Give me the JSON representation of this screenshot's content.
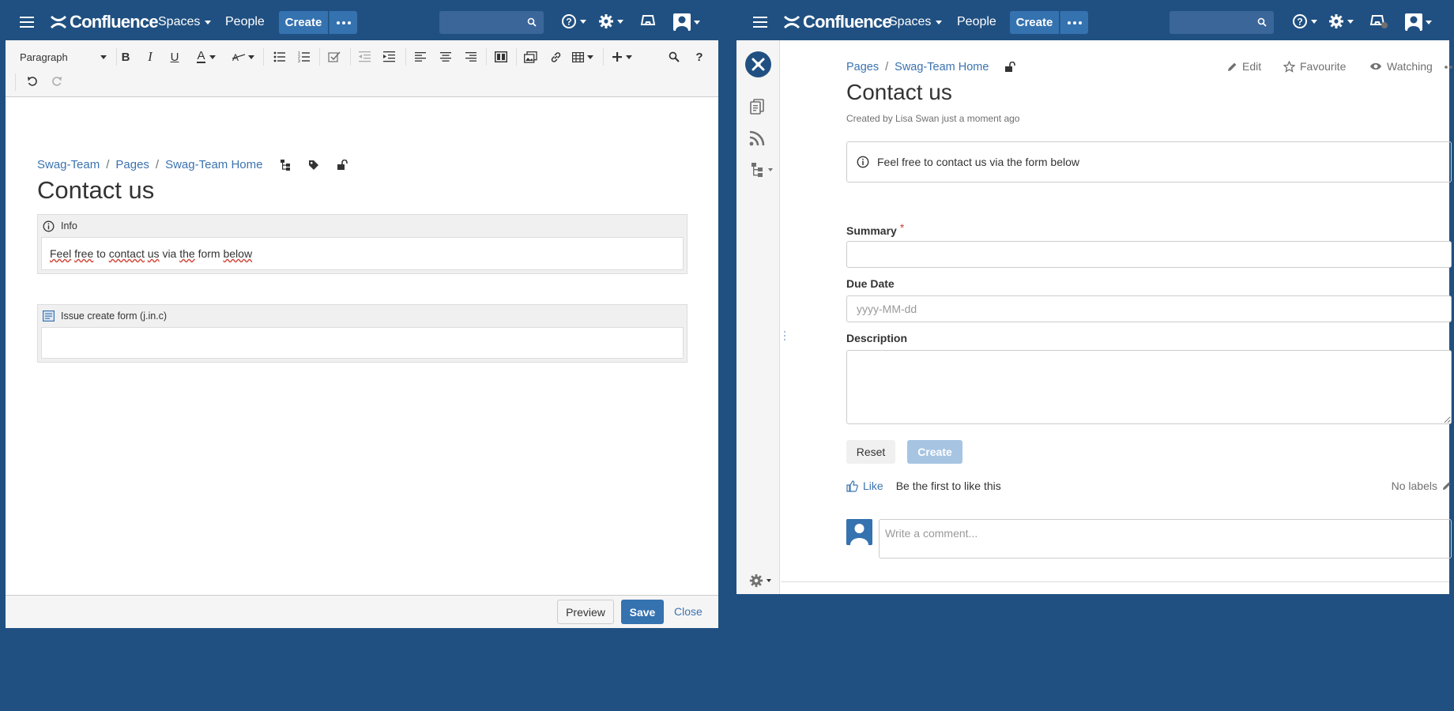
{
  "colors": {
    "brand_blue": "#205081",
    "button_blue": "#3572b0",
    "link_blue": "#3b73af",
    "required_red": "#d04437",
    "disabled_blue": "#a7c4e3"
  },
  "header": {
    "logo_text": "Confluence",
    "spaces_label": "Spaces",
    "people_label": "People",
    "create_label": "Create",
    "icons": [
      "menu-icon",
      "confluence-logo-icon",
      "more-dots-icon",
      "search-icon",
      "help-icon",
      "settings-icon",
      "notifications-icon",
      "user-avatar-icon"
    ]
  },
  "editor": {
    "toolbar": {
      "paragraph_label": "Paragraph",
      "bold": "B",
      "italic": "I",
      "underline": "U",
      "text_color": "A",
      "help": "?",
      "icons": [
        "bold-icon",
        "italic-icon",
        "underline-icon",
        "text-color-icon",
        "formatting-icon",
        "bullet-list-icon",
        "numbered-list-icon",
        "task-list-icon",
        "outdent-icon",
        "indent-icon",
        "align-left-icon",
        "align-center-icon",
        "align-right-icon",
        "page-layout-icon",
        "insert-image-icon",
        "link-icon",
        "table-icon",
        "insert-more-icon",
        "find-icon",
        "help-icon",
        "undo-icon",
        "redo-icon"
      ]
    },
    "breadcrumbs": [
      "Swag-Team",
      "Pages",
      "Swag-Team Home"
    ],
    "breadcrumb_separator": "/",
    "title": "Contact us",
    "info_macro": {
      "header": "Info",
      "body_words": [
        "Feel",
        "free",
        "to",
        "contact",
        "us",
        "via",
        "the",
        "form",
        "below"
      ]
    },
    "form_macro": {
      "header": "Issue create form (j.in.c)"
    },
    "footer": {
      "preview_label": "Preview",
      "save_label": "Save",
      "close_label": "Close"
    }
  },
  "view": {
    "breadcrumbs": [
      "Pages",
      "Swag-Team Home"
    ],
    "breadcrumb_separator": "/",
    "actions": {
      "edit_label": "Edit",
      "favourite_label": "Favourite",
      "watching_label": "Watching"
    },
    "title": "Contact us",
    "meta_prefix": "Created by",
    "meta_author": "Lisa Swan",
    "meta_time": "just a moment ago",
    "info_text": "Feel free to contact us via the form below",
    "form": {
      "summary_label": "Summary",
      "required_mark": "*",
      "due_date_label": "Due Date",
      "due_date_placeholder": "yyyy-MM-dd",
      "description_label": "Description",
      "reset_label": "Reset",
      "create_label": "Create"
    },
    "like_label": "Like",
    "like_prompt": "Be the first to like this",
    "labels_text": "No labels",
    "comment_placeholder": "Write a comment..."
  }
}
